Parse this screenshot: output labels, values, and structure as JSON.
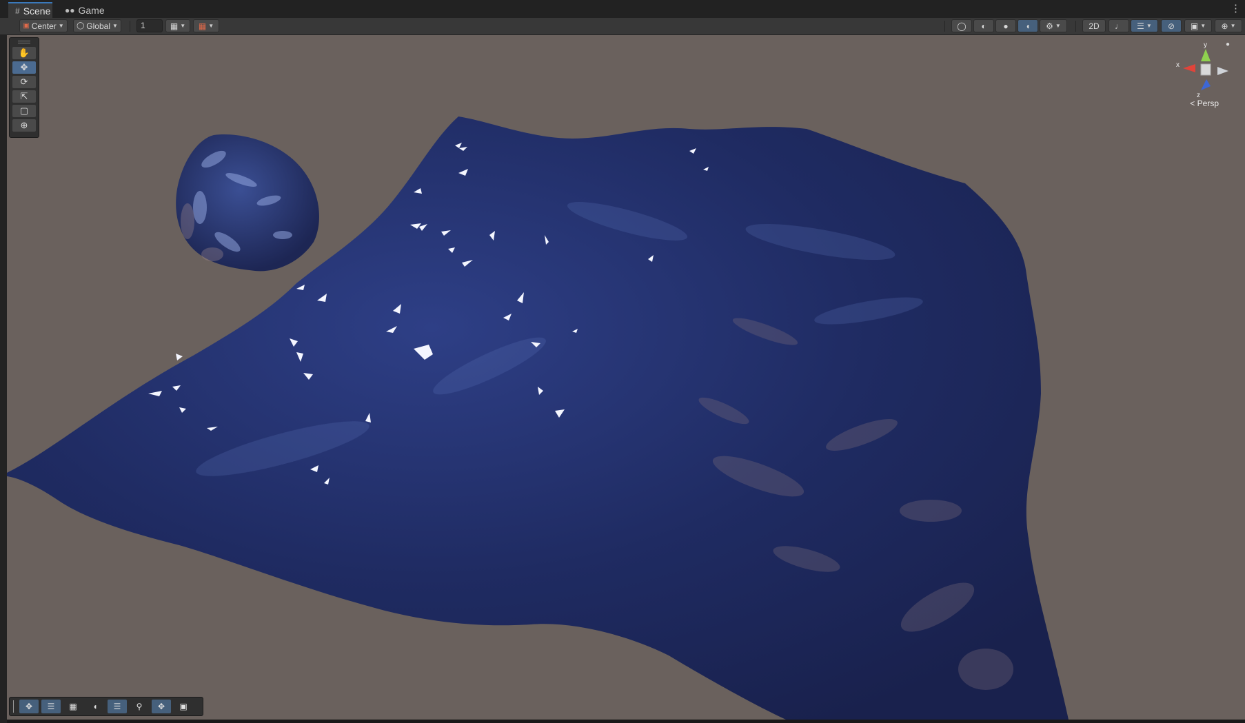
{
  "tabs": [
    {
      "label": "Scene",
      "icon": "grid-icon",
      "active": true
    },
    {
      "label": "Game",
      "icon": "gamepad-icon",
      "active": false
    }
  ],
  "toolbar": {
    "pivot_mode": "Center",
    "pivot_rotation": "Global",
    "grid_increment": "1",
    "mode_2d": "2D"
  },
  "gizmo": {
    "y_label": "y",
    "x_label": "x",
    "z_label": "z",
    "projection": "Persp"
  },
  "colors": {
    "viewport_bg": "#6a615d",
    "water_deep": "#1c2552",
    "water_mid": "#2a3a78",
    "accent": "#46607c"
  },
  "tools": [
    "hand-tool",
    "move-tool",
    "rotate-tool",
    "scale-tool",
    "rect-tool",
    "transform-tool"
  ],
  "bottom_tools": [
    "move-icon",
    "sliders-icon",
    "grid-icon",
    "sphere-icon",
    "layers-icon",
    "search-icon",
    "move-arrows-icon",
    "camera-icon"
  ]
}
